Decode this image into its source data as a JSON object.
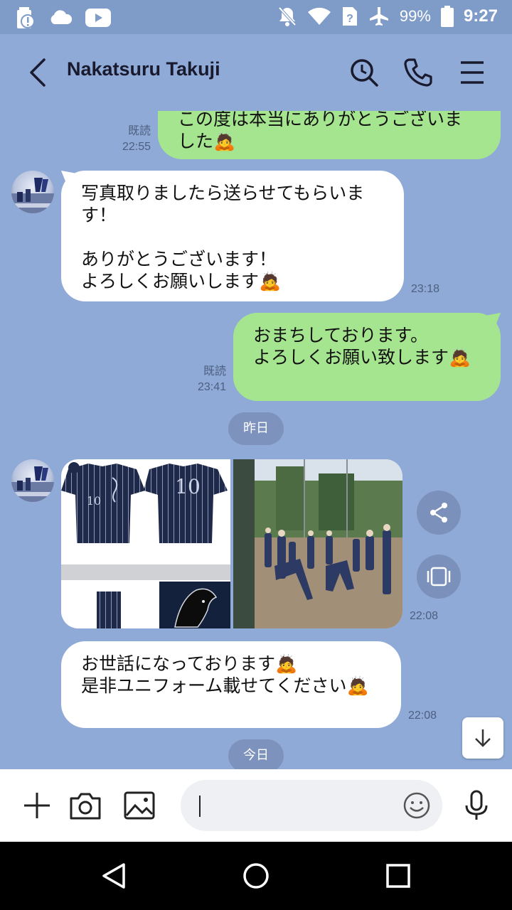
{
  "status_bar": {
    "battery_percent": "99%",
    "time": "9:27",
    "icons": [
      "battery-alert-icon",
      "cloud-icon",
      "youtube-icon",
      "bell-off-icon",
      "wifi-icon",
      "sim-unknown-icon",
      "airplane-icon",
      "battery-icon"
    ]
  },
  "header": {
    "contact_name": "Nakatsuru Takuji",
    "icons": [
      "back-icon",
      "search-icon",
      "call-icon",
      "menu-icon"
    ]
  },
  "messages": [
    {
      "side": "right",
      "text": "この度は本当にありがとうございました",
      "read": "既読",
      "time": "22:55"
    },
    {
      "side": "left",
      "text": "写真取りましたら送らせてもらいます！\n\nありがとうございます！\nよろしくお願いします🙇",
      "time": "23:18"
    },
    {
      "side": "right",
      "text": "おまちしております。\nよろしくお願い致します🙇",
      "read": "既読",
      "time": "23:41"
    },
    {
      "side": "left",
      "type": "photos",
      "time": "22:08"
    },
    {
      "side": "left",
      "text": "お世話になっております🙇\n是非ユニフォーム載せてください🙇",
      "time": "22:08"
    }
  ],
  "first_message_line1": "この度は本当にありがとうございま",
  "first_message_line2": "した🙇",
  "date_separators": {
    "yesterday": "昨日",
    "today": "今日"
  },
  "photo_content": {
    "jersey_number": "10"
  },
  "input": {
    "placeholder": ""
  },
  "colors": {
    "chat_bg": "#8faad6",
    "green_bubble": "#a6e58f",
    "white_bubble": "#ffffff",
    "navy_jersey": "#1f2a4a"
  }
}
